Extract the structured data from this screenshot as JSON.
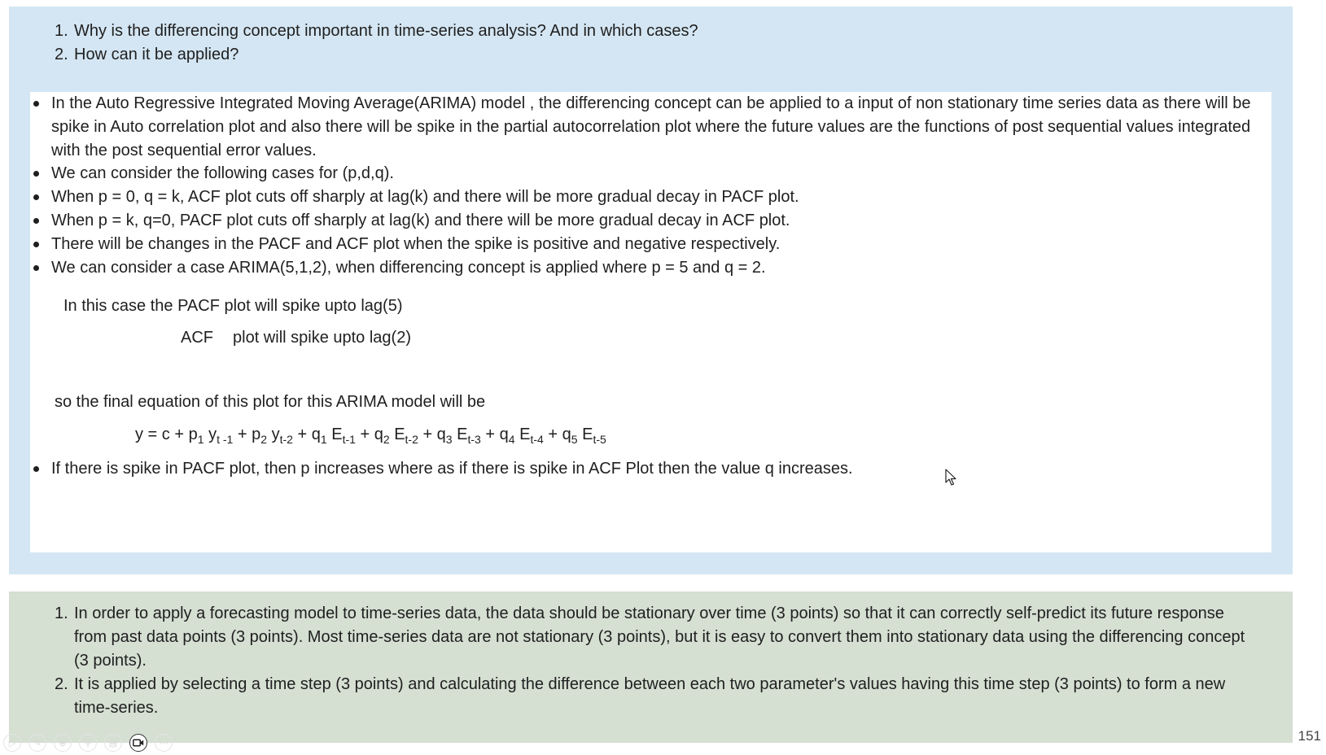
{
  "questions": [
    {
      "number": "1.",
      "text": "Why is the differencing concept important in time-series analysis? And in which cases?"
    },
    {
      "number": "2.",
      "text": "How can it be applied?"
    }
  ],
  "answer": {
    "bullets": [
      "In the Auto Regressive Integrated Moving Average(ARIMA) model , the differencing concept can be applied to a input of non stationary time series data as there will be spike in Auto correlation plot and also there will be spike in the partial autocorrelation plot where the future values are the functions of post sequential values integrated with the post sequential error values.",
      "We can consider the following cases for (p,d,q).",
      "When p = 0, q = k, ACF plot cuts off sharply at lag(k) and there will be more gradual decay in PACF plot.",
      "When p = k, q=0, PACF plot cuts off sharply at lag(k) and there will be more gradual decay in ACF plot.",
      "There will be changes in the PACF and ACF plot when the spike is positive and negative respectively.",
      "We can consider a case ARIMA(5,1,2), when differencing concept is applied where p = 5 and q = 2.",
      "If there is spike in PACF plot, then p increases where as if there is spike in ACF Plot then the value q increases."
    ],
    "case_line1": "In this case the PACF plot will spike upto lag(5)",
    "case_line2_label": "ACF",
    "case_line2_text": "plot will spike upto lag(2)",
    "final_equation_intro": "so the final equation of this plot for this ARIMA model will be",
    "equation": {
      "y": "y = c +",
      "p1": "p",
      "p1_sub": "1",
      "y1": "y",
      "y1_sub": "t -1",
      "p2": "+ p",
      "p2_sub": "2",
      "y2": "y",
      "y2_sub": "t-2",
      "q1": "+ q",
      "q1_sub": "1",
      "e1": "E",
      "e1_sub": "t-1",
      "q2": "+ q",
      "q2_sub": "2",
      "e2": "E",
      "e2_sub": "t-2",
      "q3": "+ q",
      "q3_sub": "3",
      "e3": "E",
      "e3_sub": "t-3",
      "q4": "+ q",
      "q4_sub": "4",
      "e4": "E",
      "e4_sub": "t-4",
      "q5": "+ q",
      "q5_sub": "5",
      "e5": "E",
      "e5_sub": "t-5"
    }
  },
  "answer_key": [
    {
      "number": "1.",
      "text": "In order to apply a forecasting model to time-series data, the data should be stationary over time (3 points) so that it can correctly self-predict its future response from past data points (3 points). Most time-series data are not stationary (3 points), but it is easy to convert them into stationary data using the differencing concept (3 points)."
    },
    {
      "number": "2.",
      "text": "It is applied by selecting a time step (3 points) and calculating the difference between each two parameter's values having this time step (3 points) to form a new time-series."
    }
  ],
  "toolbar": {
    "buttons": [
      "play-icon",
      "pen-icon",
      "globe-icon",
      "zoom-icon",
      "slides-icon",
      "camera-icon",
      "more-icon"
    ],
    "glyphs": [
      "▷",
      "✎",
      "⊕",
      "⚲",
      "▤",
      "◙",
      "⋯"
    ]
  },
  "page_number": "151",
  "colors": {
    "question_panel": "#d4e6f3",
    "answer_box": "#ffffff",
    "key_panel": "#d5dfd2"
  }
}
